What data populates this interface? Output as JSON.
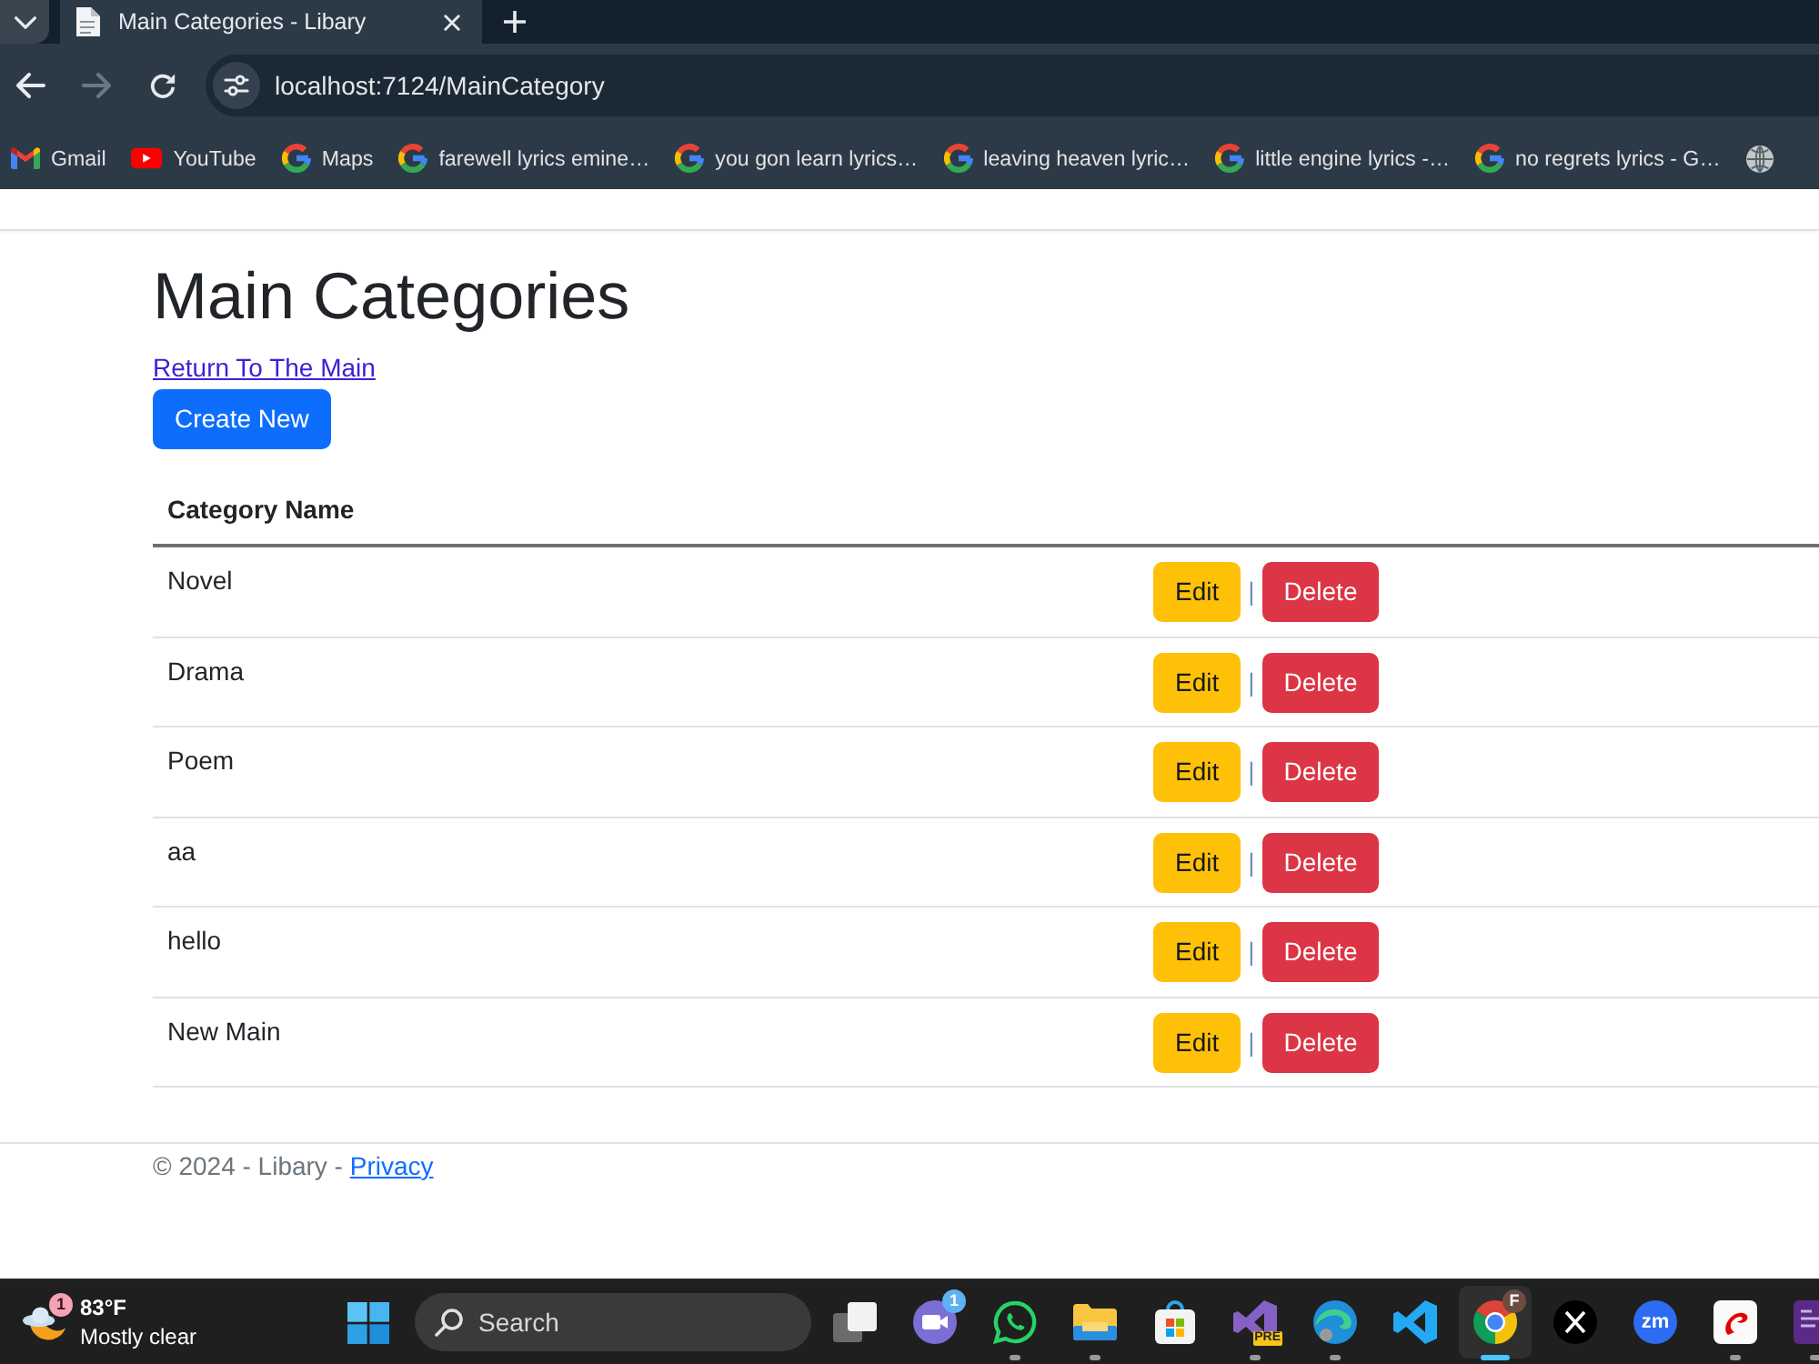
{
  "browser": {
    "tabs": [
      {
        "title": "Main Categories - Libary",
        "selected": true
      }
    ],
    "nav_buttons": [
      {
        "kind": "back",
        "disabled": false
      },
      {
        "kind": "forward",
        "disabled": true
      },
      {
        "kind": "reload",
        "disabled": false
      }
    ],
    "address": "localhost:7124/MainCategory",
    "bookmarks": [
      {
        "kind": "gmail",
        "label": "Gmail"
      },
      {
        "kind": "youtube",
        "label": "YouTube"
      },
      {
        "kind": "google",
        "label": "Maps"
      },
      {
        "kind": "google",
        "label": "farewell lyrics emine…"
      },
      {
        "kind": "google",
        "label": "you gon learn lyrics…"
      },
      {
        "kind": "google",
        "label": "leaving heaven lyric…"
      },
      {
        "kind": "google",
        "label": "little engine lyrics -…"
      },
      {
        "kind": "google",
        "label": "no regrets lyrics - G…"
      },
      {
        "kind": "globe"
      }
    ]
  },
  "page": {
    "title": "Main Categories",
    "return_link": "Return To The Main",
    "create_button": "Create New",
    "table": {
      "columns": [
        "Category Name"
      ],
      "rows": [
        {
          "name": "Novel",
          "actions": [
            {
              "kind": "edit",
              "label": "Edit"
            },
            {
              "kind": "delete",
              "label": "Delete"
            }
          ],
          "separator": "|"
        },
        {
          "name": "Drama",
          "actions": [
            {
              "kind": "edit",
              "label": "Edit"
            },
            {
              "kind": "delete",
              "label": "Delete"
            }
          ],
          "separator": "|"
        },
        {
          "name": "Poem",
          "actions": [
            {
              "kind": "edit",
              "label": "Edit"
            },
            {
              "kind": "delete",
              "label": "Delete"
            }
          ],
          "separator": "|"
        },
        {
          "name": "aa",
          "actions": [
            {
              "kind": "edit",
              "label": "Edit"
            },
            {
              "kind": "delete",
              "label": "Delete"
            }
          ],
          "separator": "|"
        },
        {
          "name": "hello",
          "actions": [
            {
              "kind": "edit",
              "label": "Edit"
            },
            {
              "kind": "delete",
              "label": "Delete"
            }
          ],
          "separator": "|"
        },
        {
          "name": "New Main",
          "actions": [
            {
              "kind": "edit",
              "label": "Edit"
            },
            {
              "kind": "delete",
              "label": "Delete"
            }
          ],
          "separator": "|"
        }
      ]
    }
  },
  "footer": {
    "text": "© 2024 - Libary -",
    "link": "Privacy"
  },
  "taskbar": {
    "weather": {
      "badge": {
        "kind": "alert",
        "text": "1"
      },
      "temperature": "83°F",
      "condition": "Mostly clear"
    },
    "search": {
      "placeholder": "Search"
    },
    "apps": [
      {
        "kind": "taskview",
        "running": false,
        "selected": false
      },
      {
        "kind": "meet",
        "badge": {
          "kind": "count",
          "text": "1"
        },
        "running": false,
        "selected": false
      },
      {
        "kind": "whatsapp",
        "running": true,
        "selected": false
      },
      {
        "kind": "files",
        "running": true,
        "selected": false
      },
      {
        "kind": "store",
        "running": false,
        "selected": false
      },
      {
        "kind": "visualstudio",
        "tag": "PRE",
        "running": true,
        "selected": false
      },
      {
        "kind": "edge",
        "running": true,
        "selected": false
      },
      {
        "kind": "vscode",
        "running": false,
        "selected": false
      },
      {
        "kind": "chrome",
        "badge": {
          "kind": "profile",
          "text": "F"
        },
        "running": true,
        "selected": true
      },
      {
        "kind": "x",
        "running": false,
        "selected": false
      },
      {
        "kind": "zoom",
        "label": "zm",
        "running": false,
        "selected": false
      },
      {
        "kind": "airtel",
        "running": true,
        "selected": false
      },
      {
        "kind": "terminal",
        "running": true,
        "selected": false
      }
    ]
  }
}
